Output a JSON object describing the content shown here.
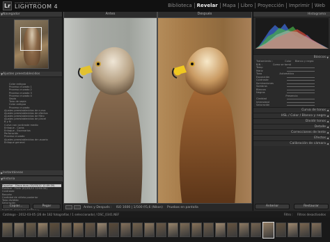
{
  "app": {
    "logo": "Lr",
    "subtitle": "ADOBE PHOTOSHOP",
    "name": "LIGHTROOM 4"
  },
  "modules": [
    "Biblioteca",
    "Revelar",
    "Mapa",
    "Libro",
    "Proyección",
    "Imprimir",
    "Web"
  ],
  "active_module": "Revelar",
  "left": {
    "navigator": "Navegador",
    "presets_title": "Ajustes preestablecidos",
    "presets": [
      "Color antiguo",
      "Proceso cruzado 1",
      "Proceso cruzado 2",
      "Proceso cruzado 3",
      "Proceso cruzado 4",
      "Sepia",
      "Tono de sepia",
      "Color antiguo",
      "Proceso cruzado",
      "Ajustes preestablecidos de curva",
      "Ajustes preestablecidos de efectos",
      "Ajustes preestablecidos de filtro",
      "Ajustes preestablecidos de pincel",
      "B y N",
      "Curva con contraste medio",
      "Enfoque - Caras",
      "Enfoque - Escenarios",
      "Perforación",
      "Proceso cruzado",
      "Ajustes preestablecidos de usuario",
      "Enfoque general"
    ],
    "snapshots": "Instantáneas",
    "history_title": "Historia",
    "history": [
      "Exportar - Disco duro (02/03/12 12:09:39)",
      "Publicar - Flickr (02/03/12 12:04:34)",
      "Contraste",
      "Recorte",
      "Cantidad de viñeta posterior",
      "Tono dividido",
      "Saturación",
      "Saturación",
      "Importar (02/03/12 11:33:57)"
    ],
    "copy": "Copiar...",
    "paste": "Pegar"
  },
  "center": {
    "before": "Antes",
    "after": "Después",
    "toolbar_label": "Antes y Después :",
    "filename": "ISO 1600 | 1/500 f/5,6 (Nikon)",
    "slideshow": "Pruebas en pantalla"
  },
  "right": {
    "histogram": "Histograma",
    "basic": "Básicos",
    "treatment": "Tratamiento :",
    "color": "Color",
    "bw": "Blanco y negro",
    "wb": "B/N :",
    "wb_value": "Como se tomó",
    "temp": "Temp",
    "tint": "Matiz",
    "tone": "Tono",
    "auto": "Automático",
    "exposure": "Exposición",
    "contrast": "Contraste",
    "highlights": "Iluminaciones",
    "shadows": "Sombras",
    "whites": "Blancos",
    "blacks": "Negros",
    "presence": "Presencia",
    "clarity": "Claridad",
    "vibrance": "Intensidad",
    "saturation": "Saturación",
    "sections": [
      "Curva de tonos",
      "HSL / Color / Blanco y negro",
      "Dividir tonos",
      "Detalle",
      "Correcciones de lente",
      "Efectos",
      "Calibración de cámara"
    ],
    "previous": "Anterior",
    "reset": "Restaurar"
  },
  "filmstrip": {
    "info": "Catálogo - 2012-03-05 (26 de 182 fotografías / 1 seleccionado) / DSC_0341.NEF",
    "filter": "Filtro :",
    "filter_value": "Filtros desactivados"
  },
  "colors": {
    "accent": "#cccccc",
    "active_module": "#eeeeee"
  }
}
